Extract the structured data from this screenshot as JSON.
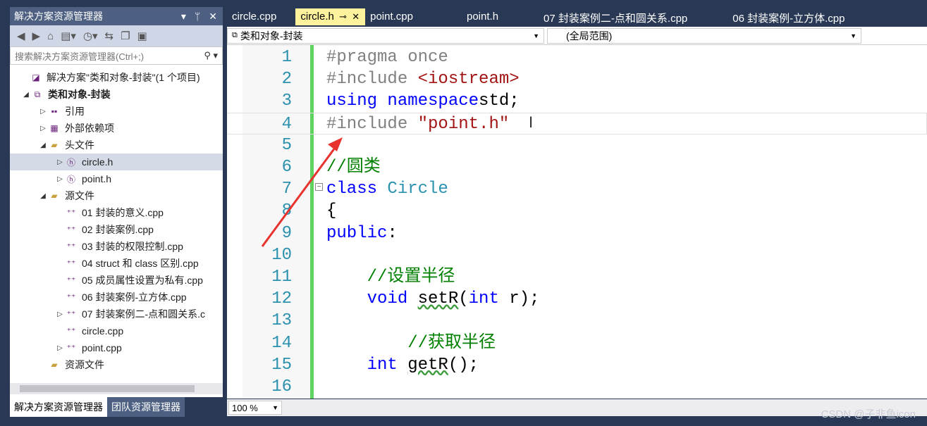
{
  "solution_explorer": {
    "title": "解决方案资源管理器",
    "search_placeholder": "搜索解决方案资源管理器(Ctrl+;)",
    "tree": [
      {
        "label": "解决方案\"类和对象-封装\"(1 个项目)",
        "indent": 0,
        "exp": "",
        "icon": "solution-icon"
      },
      {
        "label": "类和对象-封装",
        "indent": 1,
        "exp": "◢",
        "icon": "project-icon",
        "bold": true
      },
      {
        "label": "引用",
        "indent": 2,
        "exp": "▷",
        "icon": "references-icon"
      },
      {
        "label": "外部依赖项",
        "indent": 2,
        "exp": "▷",
        "icon": "external-deps-icon"
      },
      {
        "label": "头文件",
        "indent": 2,
        "exp": "◢",
        "icon": "folder-icon"
      },
      {
        "label": "circle.h",
        "indent": 3,
        "exp": "▷",
        "icon": "header-file-icon",
        "selected": true
      },
      {
        "label": "point.h",
        "indent": 3,
        "exp": "▷",
        "icon": "header-file-icon"
      },
      {
        "label": "源文件",
        "indent": 2,
        "exp": "◢",
        "icon": "folder-icon"
      },
      {
        "label": "01 封装的意义.cpp",
        "indent": 3,
        "exp": "",
        "icon": "cpp-file-icon"
      },
      {
        "label": "02 封装案例.cpp",
        "indent": 3,
        "exp": "",
        "icon": "cpp-file-icon"
      },
      {
        "label": "03 封装的权限控制.cpp",
        "indent": 3,
        "exp": "",
        "icon": "cpp-file-icon"
      },
      {
        "label": "04 struct 和 class 区别.cpp",
        "indent": 3,
        "exp": "",
        "icon": "cpp-file-icon"
      },
      {
        "label": "05 成员属性设置为私有.cpp",
        "indent": 3,
        "exp": "",
        "icon": "cpp-file-icon"
      },
      {
        "label": "06 封装案例-立方体.cpp",
        "indent": 3,
        "exp": "",
        "icon": "cpp-file-icon"
      },
      {
        "label": "07 封装案例二-点和圆关系.c",
        "indent": 3,
        "exp": "▷",
        "icon": "cpp-file-icon"
      },
      {
        "label": "circle.cpp",
        "indent": 3,
        "exp": "",
        "icon": "cpp-file-icon"
      },
      {
        "label": "point.cpp",
        "indent": 3,
        "exp": "▷",
        "icon": "cpp-file-icon"
      },
      {
        "label": "资源文件",
        "indent": 2,
        "exp": "",
        "icon": "folder-icon"
      }
    ],
    "bottom_tabs": [
      "解决方案资源管理器",
      "团队资源管理器"
    ]
  },
  "editor_tabs": [
    {
      "label": "circle.cpp"
    },
    {
      "label": "circle.h",
      "active": true
    },
    {
      "label": "point.cpp"
    },
    {
      "label": "point.h"
    },
    {
      "label": "07 封装案例二-点和圆关系.cpp"
    },
    {
      "label": "06 封装案例-立方体.cpp"
    }
  ],
  "nav": {
    "project": "类和对象-封装",
    "scope": "(全局范围)"
  },
  "code_lines": [
    [
      [
        "pp",
        "#pragma once"
      ]
    ],
    [
      [
        "pp",
        "#include "
      ],
      [
        "str",
        "<iostream>"
      ]
    ],
    [
      [
        "kw",
        "using namespace"
      ],
      [
        "",
        "std;"
      ]
    ],
    [
      [
        "pp",
        "#include "
      ],
      [
        "str",
        "\"point.h\""
      ]
    ],
    [],
    [
      [
        "cm",
        "//圆类"
      ]
    ],
    [
      [
        "kw",
        "class "
      ],
      [
        "ty",
        "Circle"
      ]
    ],
    [
      [
        "",
        "{"
      ]
    ],
    [
      [
        "kw",
        "public"
      ],
      [
        "",
        ":"
      ]
    ],
    [],
    [
      [
        "",
        "    "
      ],
      [
        "cm",
        "//设置半径"
      ]
    ],
    [
      [
        "",
        "    "
      ],
      [
        "kw",
        "void "
      ],
      [
        "sq",
        "setR"
      ],
      [
        "",
        "("
      ],
      [
        "kw",
        "int "
      ],
      [
        "",
        "r);"
      ]
    ],
    [],
    [
      [
        "",
        "        "
      ],
      [
        "cm",
        "//获取半径"
      ]
    ],
    [
      [
        "",
        "    "
      ],
      [
        "kw",
        "int "
      ],
      [
        "sq",
        "getR"
      ],
      [
        "",
        "();"
      ]
    ],
    []
  ],
  "zoom_level": "100 %",
  "watermark": "CSDN @子非鱼icon"
}
